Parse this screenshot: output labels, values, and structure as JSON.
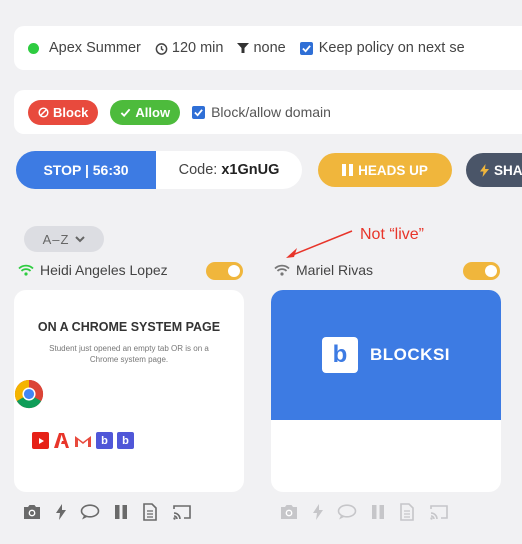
{
  "policy_bar": {
    "name": "Apex Summer",
    "duration": "120 min",
    "filter": "none",
    "keep_policy": "Keep policy on next se"
  },
  "action_bar": {
    "block_label": "Block",
    "allow_label": "Allow",
    "domain_label": "Block/allow domain"
  },
  "controls": {
    "stop_label": "STOP | 56:30",
    "code_label": "Code:",
    "code_value": "x1GnUG",
    "heads_up_label": "HEADS UP",
    "share_label": "SHA"
  },
  "sort": {
    "label": "A–Z"
  },
  "annotation": {
    "text": "Not “live”",
    "color": "#e8352a"
  },
  "students": [
    {
      "name": "Heidi Angeles Lopez",
      "live": true,
      "card_title": "ON A CHROME SYSTEM PAGE",
      "card_desc": "Student just opened an empty tab OR is on a Chrome system page."
    },
    {
      "name": "Mariel Rivas",
      "live": false,
      "brand": "BLOCKSI",
      "brand_letter": "b"
    }
  ],
  "colors": {
    "accent_blue": "#3d7be3",
    "heads_up": "#f0b63c",
    "block_red": "#e84a3d",
    "allow_green": "#4dbb3c",
    "live_green": "#2ecc40"
  }
}
